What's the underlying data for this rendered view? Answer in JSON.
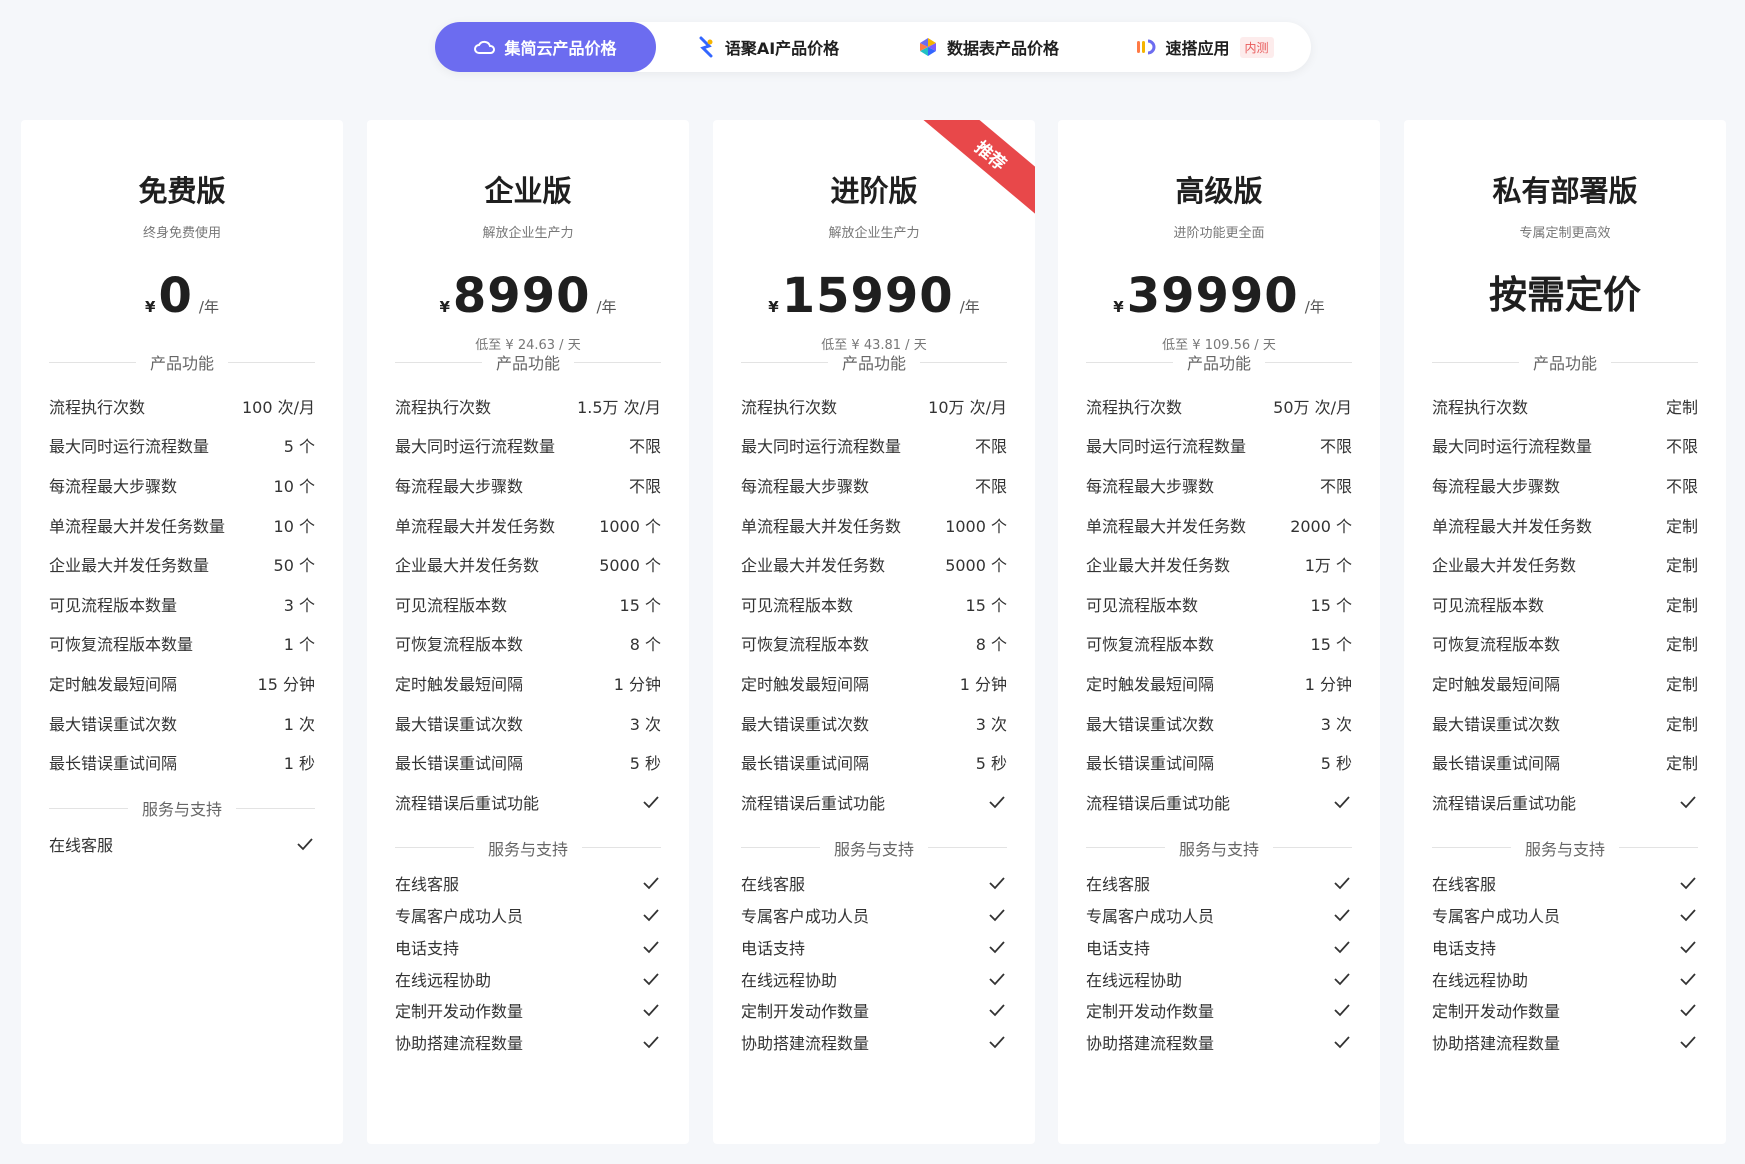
{
  "tabs": [
    {
      "label": "集简云产品价格",
      "icon": "cloud-icon"
    },
    {
      "label": "语聚AI产品价格",
      "icon": "ai-icon"
    },
    {
      "label": "数据表产品价格",
      "icon": "datasheet-icon"
    },
    {
      "label": "速搭应用",
      "icon": "app-builder-icon",
      "badge": "内测"
    }
  ],
  "accent_color": "#6c6cf0",
  "plans": [
    {
      "name": "免费版",
      "desc": "终身免费使用",
      "currency": "¥",
      "price": "0",
      "unit": "/年",
      "per_day": "",
      "features_title": "产品功能",
      "features": [
        {
          "label": "流程执行次数",
          "value": "100 次/月"
        },
        {
          "label": "最大同时运行流程数量",
          "value": "5 个"
        },
        {
          "label": "每流程最大步骤数",
          "value": "10 个"
        },
        {
          "label": "单流程最大并发任务数量",
          "value": "10 个"
        },
        {
          "label": "企业最大并发任务数量",
          "value": "50 个"
        },
        {
          "label": "可见流程版本数量",
          "value": "3 个"
        },
        {
          "label": "可恢复流程版本数量",
          "value": "1 个"
        },
        {
          "label": "定时触发最短间隔",
          "value": "15 分钟"
        },
        {
          "label": "最大错误重试次数",
          "value": "1 次"
        },
        {
          "label": "最长错误重试间隔",
          "value": "1 秒"
        }
      ],
      "service_title": "服务与支持",
      "services": [
        "在线客服"
      ]
    },
    {
      "name": "企业版",
      "desc": "解放企业生产力",
      "currency": "¥",
      "price": "8990",
      "unit": "/年",
      "per_day": "低至 ¥ 24.63 / 天",
      "features_title": "产品功能",
      "features": [
        {
          "label": "流程执行次数",
          "value": "1.5万 次/月"
        },
        {
          "label": "最大同时运行流程数量",
          "value": "不限"
        },
        {
          "label": "每流程最大步骤数",
          "value": "不限"
        },
        {
          "label": "单流程最大并发任务数",
          "value": "1000 个"
        },
        {
          "label": "企业最大并发任务数",
          "value": "5000 个"
        },
        {
          "label": "可见流程版本数",
          "value": "15 个"
        },
        {
          "label": "可恢复流程版本数",
          "value": "8 个"
        },
        {
          "label": "定时触发最短间隔",
          "value": "1 分钟"
        },
        {
          "label": "最大错误重试次数",
          "value": "3 次"
        },
        {
          "label": "最长错误重试间隔",
          "value": "5 秒"
        },
        {
          "label": "流程错误后重试功能",
          "value": "✓"
        }
      ],
      "service_title": "服务与支持",
      "services": [
        "在线客服",
        "专属客户成功人员",
        "电话支持",
        "在线远程协助",
        "定制开发动作数量",
        "协助搭建流程数量"
      ]
    },
    {
      "name": "进阶版",
      "desc": "解放企业生产力",
      "currency": "¥",
      "price": "15990",
      "unit": "/年",
      "per_day": "低至 ¥ 43.81 / 天",
      "ribbon": "推荐",
      "features_title": "产品功能",
      "features": [
        {
          "label": "流程执行次数",
          "value": "10万 次/月"
        },
        {
          "label": "最大同时运行流程数量",
          "value": "不限"
        },
        {
          "label": "每流程最大步骤数",
          "value": "不限"
        },
        {
          "label": "单流程最大并发任务数",
          "value": "1000 个"
        },
        {
          "label": "企业最大并发任务数",
          "value": "5000 个"
        },
        {
          "label": "可见流程版本数",
          "value": "15 个"
        },
        {
          "label": "可恢复流程版本数",
          "value": "8 个"
        },
        {
          "label": "定时触发最短间隔",
          "value": "1 分钟"
        },
        {
          "label": "最大错误重试次数",
          "value": "3 次"
        },
        {
          "label": "最长错误重试间隔",
          "value": "5 秒"
        },
        {
          "label": "流程错误后重试功能",
          "value": "✓"
        }
      ],
      "service_title": "服务与支持",
      "services": [
        "在线客服",
        "专属客户成功人员",
        "电话支持",
        "在线远程协助",
        "定制开发动作数量",
        "协助搭建流程数量"
      ]
    },
    {
      "name": "高级版",
      "desc": "进阶功能更全面",
      "currency": "¥",
      "price": "39990",
      "unit": "/年",
      "per_day": "低至 ¥ 109.56 / 天",
      "features_title": "产品功能",
      "features": [
        {
          "label": "流程执行次数",
          "value": "50万 次/月"
        },
        {
          "label": "最大同时运行流程数量",
          "value": "不限"
        },
        {
          "label": "每流程最大步骤数",
          "value": "不限"
        },
        {
          "label": "单流程最大并发任务数",
          "value": "2000 个"
        },
        {
          "label": "企业最大并发任务数",
          "value": "1万 个"
        },
        {
          "label": "可见流程版本数",
          "value": "15 个"
        },
        {
          "label": "可恢复流程版本数",
          "value": "15 个"
        },
        {
          "label": "定时触发最短间隔",
          "value": "1 分钟"
        },
        {
          "label": "最大错误重试次数",
          "value": "3 次"
        },
        {
          "label": "最长错误重试间隔",
          "value": "5 秒"
        },
        {
          "label": "流程错误后重试功能",
          "value": "✓"
        }
      ],
      "service_title": "服务与支持",
      "services": [
        "在线客服",
        "专属客户成功人员",
        "电话支持",
        "在线远程协助",
        "定制开发动作数量",
        "协助搭建流程数量"
      ]
    },
    {
      "name": "私有部署版",
      "desc": "专属定制更高效",
      "custom_price": "按需定价",
      "per_day": "",
      "features_title": "产品功能",
      "features": [
        {
          "label": "流程执行次数",
          "value": "定制"
        },
        {
          "label": "最大同时运行流程数量",
          "value": "不限"
        },
        {
          "label": "每流程最大步骤数",
          "value": "不限"
        },
        {
          "label": "单流程最大并发任务数",
          "value": "定制"
        },
        {
          "label": "企业最大并发任务数",
          "value": "定制"
        },
        {
          "label": "可见流程版本数",
          "value": "定制"
        },
        {
          "label": "可恢复流程版本数",
          "value": "定制"
        },
        {
          "label": "定时触发最短间隔",
          "value": "定制"
        },
        {
          "label": "最大错误重试次数",
          "value": "定制"
        },
        {
          "label": "最长错误重试间隔",
          "value": "定制"
        },
        {
          "label": "流程错误后重试功能",
          "value": "✓"
        }
      ],
      "service_title": "服务与支持",
      "services": [
        "在线客服",
        "专属客户成功人员",
        "电话支持",
        "在线远程协助",
        "定制开发动作数量",
        "协助搭建流程数量"
      ]
    }
  ]
}
